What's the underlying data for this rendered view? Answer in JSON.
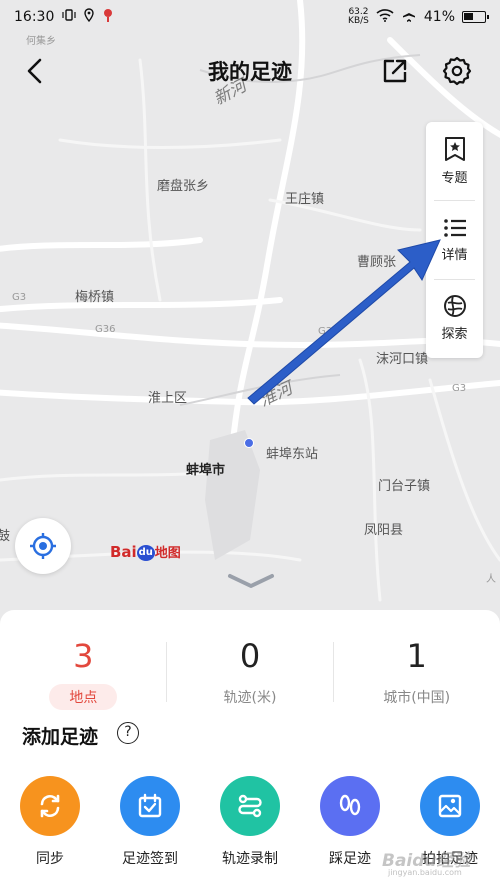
{
  "status_bar": {
    "time": "16:30",
    "net_speed_value": "63.2",
    "net_speed_unit": "KB/S",
    "battery": "41%"
  },
  "header": {
    "title": "我的足迹"
  },
  "map": {
    "places": {
      "heji": "何集乡",
      "mopan": "磨盘张乡",
      "wangzhuang": "王庄镇",
      "caogu": "曹顾张",
      "meiqiao": "梅桥镇",
      "g3_a": "G3",
      "g36_a": "G36",
      "g36_b": "G36",
      "g3_b": "G3",
      "mohekou": "沫河口镇",
      "huaishang": "淮上区",
      "bengbu_east": "蚌埠东站",
      "bengbu": "蚌埠市",
      "mentaizi": "门台子镇",
      "fengyang": "凤阳县",
      "gu": "鼓",
      "ren": "人"
    },
    "rivers": {
      "huaihe": "淮河",
      "xinhe": "新河"
    },
    "logo": {
      "bai": "Bai",
      "du": "du",
      "cn": "地图"
    }
  },
  "side_panel": {
    "items": [
      {
        "label": "专题",
        "icon": "bookmark-star-icon"
      },
      {
        "label": "详情",
        "icon": "list-icon"
      },
      {
        "label": "探索",
        "icon": "explore-icon"
      }
    ]
  },
  "stats": [
    {
      "value": "3",
      "label": "地点"
    },
    {
      "value": "0",
      "label": "轨迹(米)"
    },
    {
      "value": "1",
      "label": "城市(中国)"
    }
  ],
  "add_section": {
    "title": "添加足迹",
    "help": "?"
  },
  "actions": [
    {
      "label": "同步",
      "icon": "sync-icon",
      "color": "#f7931e"
    },
    {
      "label": "足迹签到",
      "icon": "checkin-icon",
      "color": "#2d8cf0"
    },
    {
      "label": "轨迹录制",
      "icon": "track-record-icon",
      "color": "#20c3a3"
    },
    {
      "label": "踩足迹",
      "icon": "footprint-icon",
      "color": "#5b6ff2"
    },
    {
      "label": "拍拍足迹",
      "icon": "photo-map-icon",
      "color": "#2d8cf0"
    }
  ],
  "watermark": {
    "text": "Baidu经验",
    "sub": "jingyan.baidu.com"
  },
  "colors": {
    "accent_red": "#e2483d",
    "arrow_blue": "#2c5ec8"
  }
}
